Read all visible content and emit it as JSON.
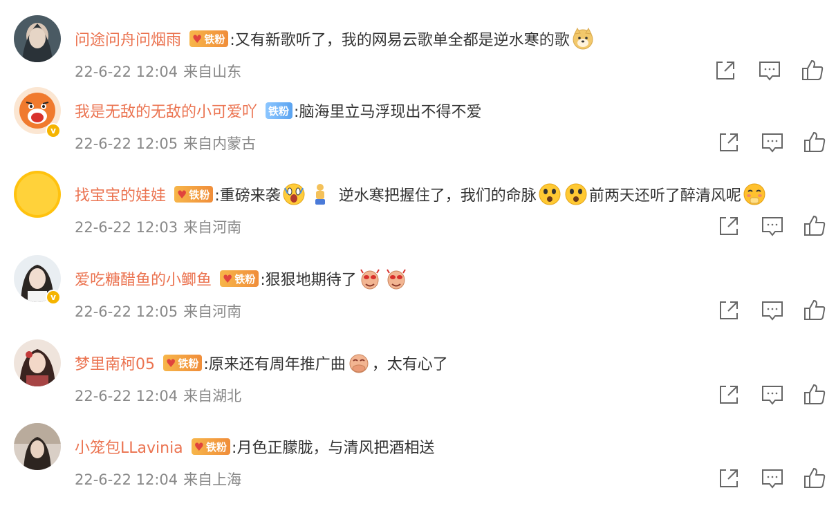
{
  "badge_labels": {
    "fan": "铁粉"
  },
  "icons": {
    "share": "share-icon",
    "comment": "comment-icon",
    "like": "thumbs-up-icon",
    "verified": "verified-v-icon",
    "heart": "heart-icon"
  },
  "colors": {
    "username": "#eb7350",
    "meta": "#888888",
    "fan_badge": "#f5a142",
    "fan_badge_blue": "#6fb2f6",
    "icon": "#666666"
  },
  "comments": [
    {
      "username": "问途问舟问烟雨",
      "text_parts": [
        ":又有新歌听了，我的网易云歌单全都是逆水寒的歌"
      ],
      "emojis": [
        "doge-emoji"
      ],
      "date": "22-6-22 12:04",
      "location": "来自山东"
    },
    {
      "username": "我是无敌的无敌的小可爱吖",
      "text_parts": [
        ":脑海里立马浮现出不得不爱"
      ],
      "date": "22-6-22 12:05",
      "location": "来自内蒙古"
    },
    {
      "username": "找宝宝的娃娃",
      "text_parts": [
        ":重磅来袭",
        "逆水寒把握住了，我们的命脉",
        "前两天还听了醉清风呢"
      ],
      "emojis": [
        "shocked-emoji",
        "standing-figure-emoji",
        "scared-emoji",
        "scared-emoji",
        "blushing-emoji"
      ],
      "date": "22-6-22 12:03",
      "location": "来自河南"
    },
    {
      "username": "爱吃糖醋鱼的小鲫鱼",
      "text_parts": [
        ":狠狠地期待了"
      ],
      "emojis": [
        "excited-emoji",
        "excited-emoji"
      ],
      "date": "22-6-22 12:05",
      "location": "来自河南"
    },
    {
      "username": "梦里南柯05",
      "text_parts": [
        ":原来还有周年推广曲",
        "，太有心了"
      ],
      "emojis": [
        "touched-hands-emoji"
      ],
      "date": "22-6-22 12:04",
      "location": "来自湖北"
    },
    {
      "username": "小笼包LLavinia",
      "text_parts": [
        ":月色正朦胧，与清风把酒相送"
      ],
      "date": "22-6-22 12:04",
      "location": "来自上海"
    }
  ]
}
